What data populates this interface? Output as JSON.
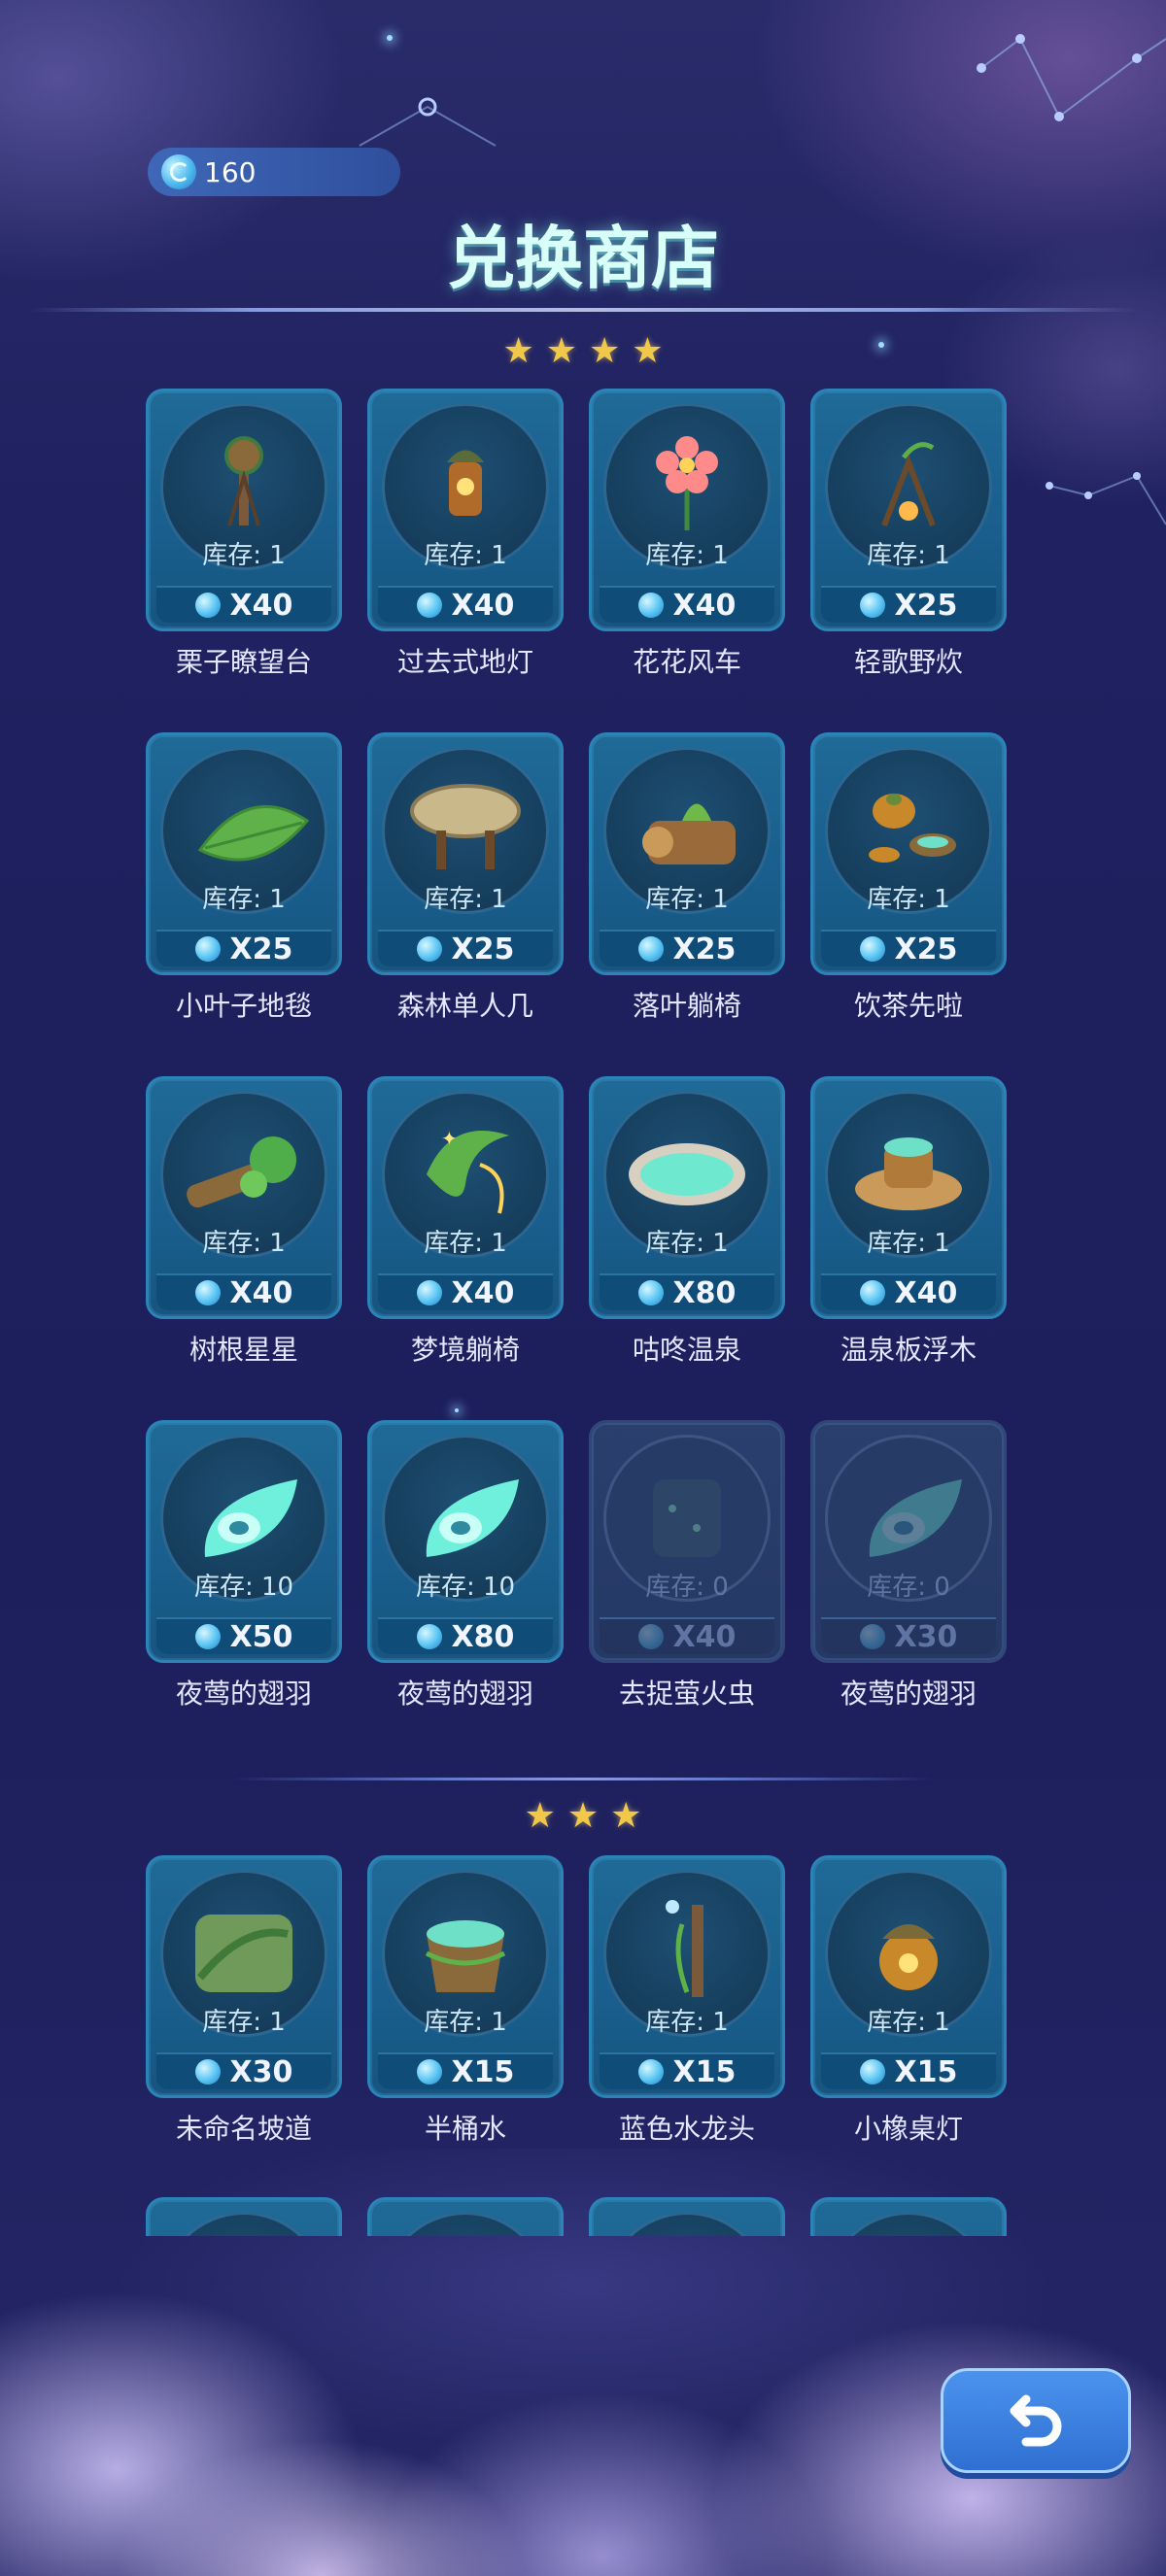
{
  "header": {
    "currency": {
      "icon": "gem-icon",
      "value": "160"
    },
    "title": "兑换商店"
  },
  "sections": [
    {
      "stars": 4,
      "items": [
        {
          "name": "栗子瞭望台",
          "stock": "库存: 1",
          "price": "X40",
          "icon": "watchtower-icon",
          "available": true
        },
        {
          "name": "过去式地灯",
          "stock": "库存: 1",
          "price": "X40",
          "icon": "ground-lamp-icon",
          "available": true
        },
        {
          "name": "花花风车",
          "stock": "库存: 1",
          "price": "X40",
          "icon": "flower-windmill-icon",
          "available": true
        },
        {
          "name": "轻歌野炊",
          "stock": "库存: 1",
          "price": "X25",
          "icon": "campfire-icon",
          "available": true
        },
        {
          "name": "小叶子地毯",
          "stock": "库存: 1",
          "price": "X25",
          "icon": "leaf-rug-icon",
          "available": true
        },
        {
          "name": "森林单人几",
          "stock": "库存: 1",
          "price": "X25",
          "icon": "stump-table-icon",
          "available": true
        },
        {
          "name": "落叶躺椅",
          "stock": "库存: 1",
          "price": "X25",
          "icon": "log-lounger-icon",
          "available": true
        },
        {
          "name": "饮茶先啦",
          "stock": "库存: 1",
          "price": "X25",
          "icon": "tea-set-icon",
          "available": true
        },
        {
          "name": "树根星星",
          "stock": "库存: 1",
          "price": "X40",
          "icon": "root-star-icon",
          "available": true
        },
        {
          "name": "梦境躺椅",
          "stock": "库存: 1",
          "price": "X40",
          "icon": "dream-chair-icon",
          "available": true
        },
        {
          "name": "咕咚温泉",
          "stock": "库存: 1",
          "price": "X80",
          "icon": "hot-spring-icon",
          "available": true
        },
        {
          "name": "温泉板浮木",
          "stock": "库存: 1",
          "price": "X40",
          "icon": "driftwood-icon",
          "available": true
        },
        {
          "name": "夜莺的翅羽",
          "stock": "库存: 10",
          "price": "X50",
          "icon": "feather-icon",
          "available": true
        },
        {
          "name": "夜莺的翅羽",
          "stock": "库存: 10",
          "price": "X80",
          "icon": "feather-icon",
          "available": true
        },
        {
          "name": "去捉萤火虫",
          "stock": "库存: 0",
          "price": "X40",
          "icon": "firefly-jar-icon",
          "available": false
        },
        {
          "name": "夜莺的翅羽",
          "stock": "库存: 0",
          "price": "X30",
          "icon": "feather-icon",
          "available": false
        }
      ]
    },
    {
      "stars": 3,
      "items": [
        {
          "name": "未命名坡道",
          "stock": "库存: 1",
          "price": "X30",
          "icon": "ramp-icon",
          "available": true
        },
        {
          "name": "半桶水",
          "stock": "库存: 1",
          "price": "X15",
          "icon": "water-bucket-icon",
          "available": true
        },
        {
          "name": "蓝色水龙头",
          "stock": "库存: 1",
          "price": "X15",
          "icon": "faucet-icon",
          "available": true
        },
        {
          "name": "小橡桌灯",
          "stock": "库存: 1",
          "price": "X15",
          "icon": "acorn-lamp-icon",
          "available": true
        }
      ]
    }
  ],
  "back_button": {
    "icon": "back-arrow-icon"
  },
  "colors": {
    "accent": "#2b84b8",
    "star": "#f2c84b",
    "title": "#d9fff9"
  }
}
